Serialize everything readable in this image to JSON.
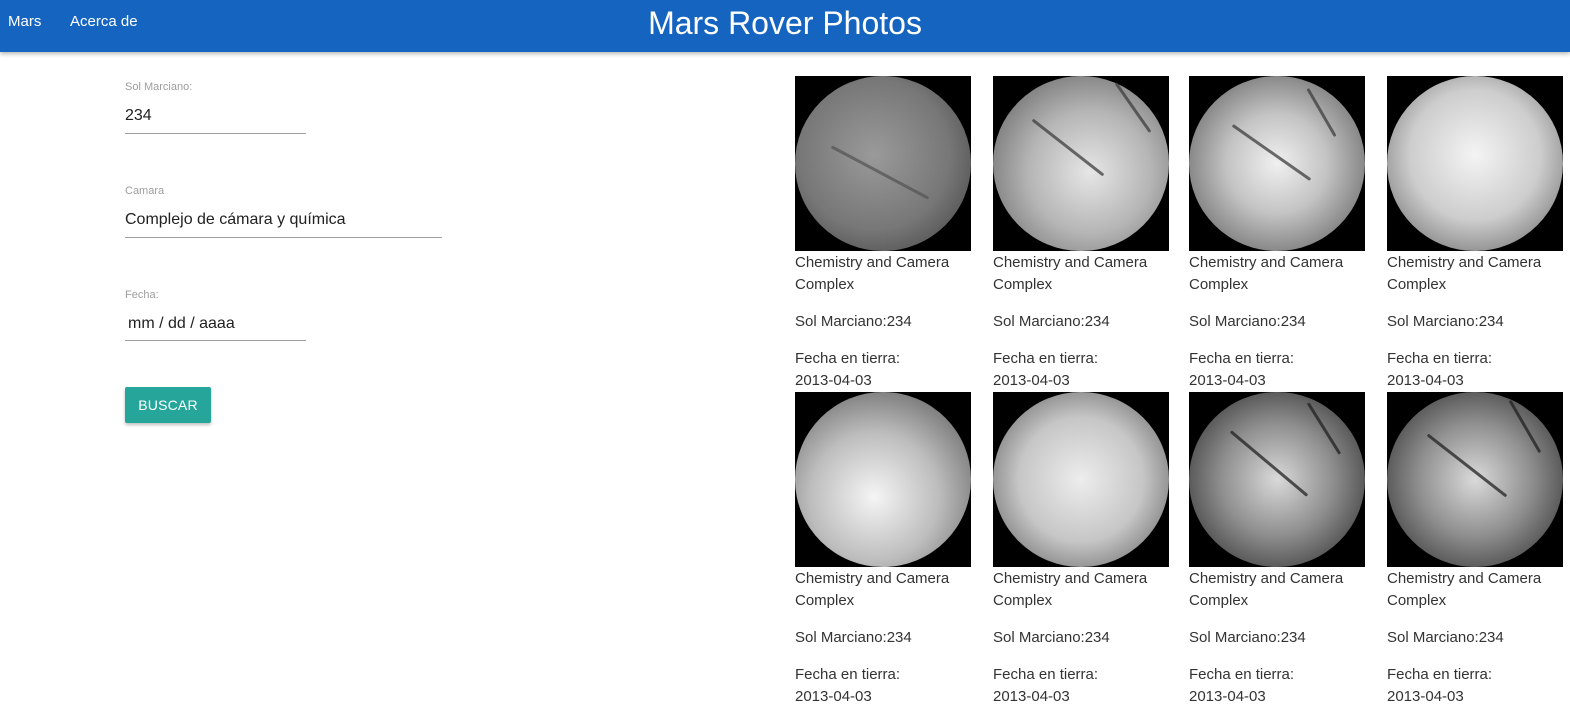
{
  "nav": {
    "brand": "Mars Rover Photos",
    "links": [
      "Mars",
      "Acerca de"
    ]
  },
  "form": {
    "sol_label": "Sol Marciano:",
    "sol_value": "234",
    "camera_label": "Camara",
    "camera_value": "Complejo de cámara y química",
    "date_label": "Fecha:",
    "date_placeholder": "mm / dd / aaaa",
    "search_button": "BUSCAR"
  },
  "photos": [
    {
      "camera": "Chemistry and Camera Complex",
      "sol": "Sol Marciano:234",
      "earth_label": "Fecha en tierra:",
      "earth_date": "2013-04-03"
    },
    {
      "camera": "Chemistry and Camera Complex",
      "sol": "Sol Marciano:234",
      "earth_label": "Fecha en tierra:",
      "earth_date": "2013-04-03"
    },
    {
      "camera": "Chemistry and Camera Complex",
      "sol": "Sol Marciano:234",
      "earth_label": "Fecha en tierra:",
      "earth_date": "2013-04-03"
    },
    {
      "camera": "Chemistry and Camera Complex",
      "sol": "Sol Marciano:234",
      "earth_label": "Fecha en tierra:",
      "earth_date": "2013-04-03"
    },
    {
      "camera": "Chemistry and Camera Complex",
      "sol": "Sol Marciano:234",
      "earth_label": "Fecha en tierra:",
      "earth_date": "2013-04-03"
    },
    {
      "camera": "Chemistry and Camera Complex",
      "sol": "Sol Marciano:234",
      "earth_label": "Fecha en tierra:",
      "earth_date": "2013-04-03"
    },
    {
      "camera": "Chemistry and Camera Complex",
      "sol": "Sol Marciano:234",
      "earth_label": "Fecha en tierra:",
      "earth_date": "2013-04-03"
    },
    {
      "camera": "Chemistry and Camera Complex",
      "sol": "Sol Marciano:234",
      "earth_label": "Fecha en tierra:",
      "earth_date": "2013-04-03"
    }
  ],
  "colors": {
    "navbar": "#1565c0",
    "button": "#26a69a",
    "label": "#9e9e9e"
  }
}
